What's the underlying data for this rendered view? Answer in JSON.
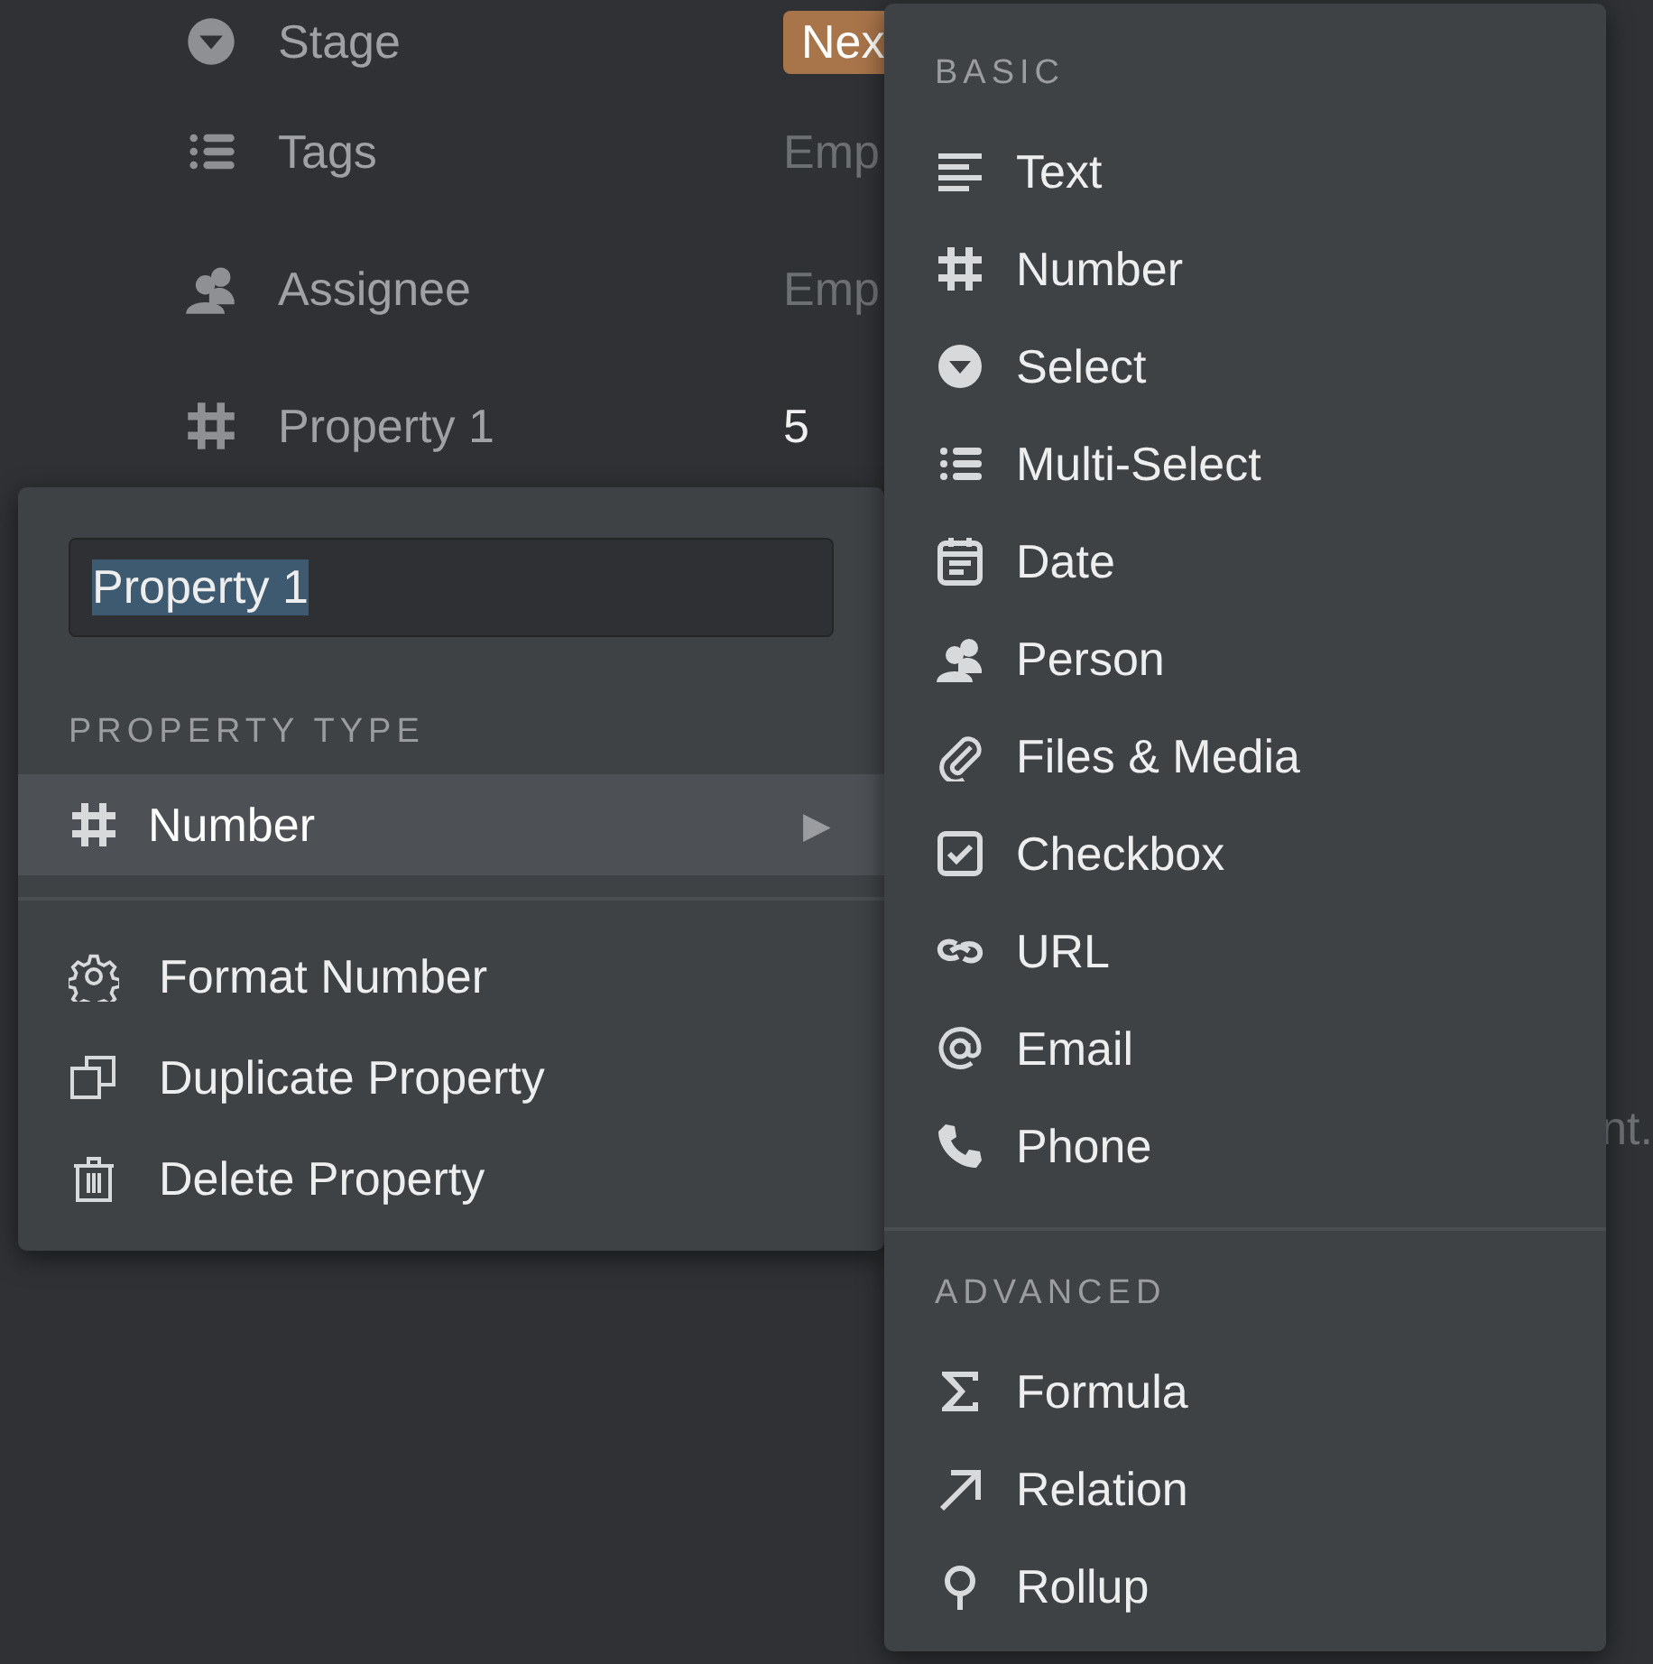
{
  "properties": [
    {
      "kind": "select",
      "label": "Stage",
      "value": {
        "kind": "badge",
        "text": "Nex",
        "color": "#a8744a"
      }
    },
    {
      "kind": "multi_select",
      "label": "Tags",
      "value": {
        "kind": "empty",
        "text": "Emp"
      }
    },
    {
      "kind": "person",
      "label": "Assignee",
      "value": {
        "kind": "empty",
        "text": "Emp"
      }
    },
    {
      "kind": "number",
      "label": "Property 1",
      "value": {
        "kind": "plain",
        "text": "5"
      }
    }
  ],
  "page_text_fragment": "nt.",
  "property_menu": {
    "name_field": {
      "value": "Property 1",
      "selected": true
    },
    "section_label": "PROPERTY TYPE",
    "type_row": {
      "kind": "number",
      "label": "Number",
      "selected": true,
      "arrow": "▶"
    },
    "actions": [
      {
        "kind": "gear",
        "label": "Format Number"
      },
      {
        "kind": "duplicate",
        "label": "Duplicate Property"
      },
      {
        "kind": "trash",
        "label": "Delete Property"
      }
    ]
  },
  "type_menu": {
    "sections": [
      {
        "label": "BASIC",
        "items": [
          {
            "kind": "text",
            "label": "Text"
          },
          {
            "kind": "number",
            "label": "Number"
          },
          {
            "kind": "select",
            "label": "Select"
          },
          {
            "kind": "multi_select",
            "label": "Multi-Select"
          },
          {
            "kind": "date",
            "label": "Date"
          },
          {
            "kind": "person",
            "label": "Person"
          },
          {
            "kind": "files",
            "label": "Files & Media"
          },
          {
            "kind": "checkbox",
            "label": "Checkbox"
          },
          {
            "kind": "url",
            "label": "URL"
          },
          {
            "kind": "email",
            "label": "Email"
          },
          {
            "kind": "phone",
            "label": "Phone"
          }
        ]
      },
      {
        "label": "ADVANCED",
        "items": [
          {
            "kind": "formula",
            "label": "Formula"
          },
          {
            "kind": "relation",
            "label": "Relation"
          },
          {
            "kind": "rollup",
            "label": "Rollup"
          }
        ]
      }
    ]
  }
}
